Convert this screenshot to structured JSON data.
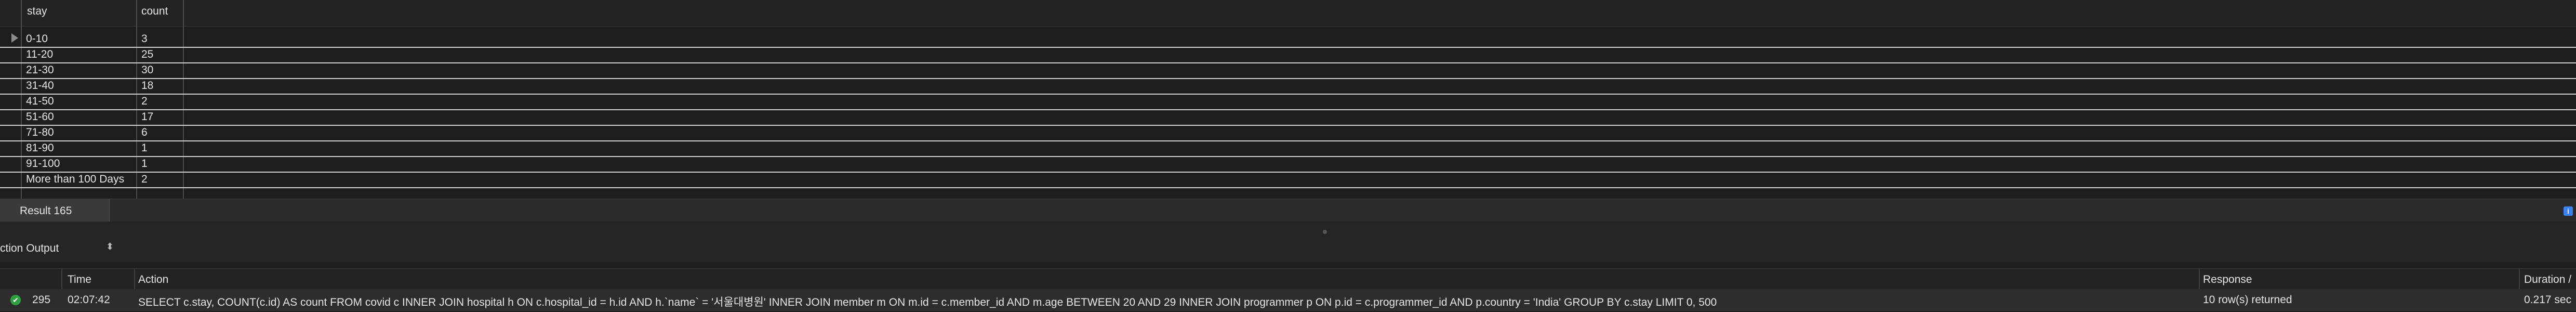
{
  "result_grid": {
    "columns": [
      "stay",
      "count"
    ],
    "rows": [
      {
        "stay": "0-10",
        "count": "3"
      },
      {
        "stay": "11-20",
        "count": "25"
      },
      {
        "stay": "21-30",
        "count": "30"
      },
      {
        "stay": "31-40",
        "count": "18"
      },
      {
        "stay": "41-50",
        "count": "2"
      },
      {
        "stay": "51-60",
        "count": "17"
      },
      {
        "stay": "71-80",
        "count": "6"
      },
      {
        "stay": "81-90",
        "count": "1"
      },
      {
        "stay": "91-100",
        "count": "1"
      },
      {
        "stay": "More than 100 Days",
        "count": "2"
      }
    ]
  },
  "result_tab": {
    "label": "Result 165"
  },
  "output": {
    "selector_label": "ction Output",
    "columns": {
      "time": "Time",
      "action": "Action",
      "response": "Response",
      "duration": "Duration /"
    },
    "rows": [
      {
        "number": "295",
        "time": "02:07:42",
        "action": "SELECT c.stay, COUNT(c.id) AS count FROM covid c INNER JOIN hospital h  ON c.hospital_id = h.id   AND h.`name` = '서울대병원' INNER JOIN member m  ON m.id = c.member_id   AND m.age BETWEEN 20 AND 29 INNER JOIN programmer p  ON p.id = c.programmer_id   AND p.country = 'India' GROUP BY c.stay LIMIT 0, 500",
        "response": "10 row(s) returned",
        "duration": "0.217 sec"
      }
    ]
  },
  "icons": {
    "row_marker": "triangle-right-icon",
    "status_ok": "check-circle-icon",
    "info": "info-icon"
  },
  "colors": {
    "background": "#1e1e1e",
    "ok": "#2ea043",
    "info": "#3b82f6"
  }
}
